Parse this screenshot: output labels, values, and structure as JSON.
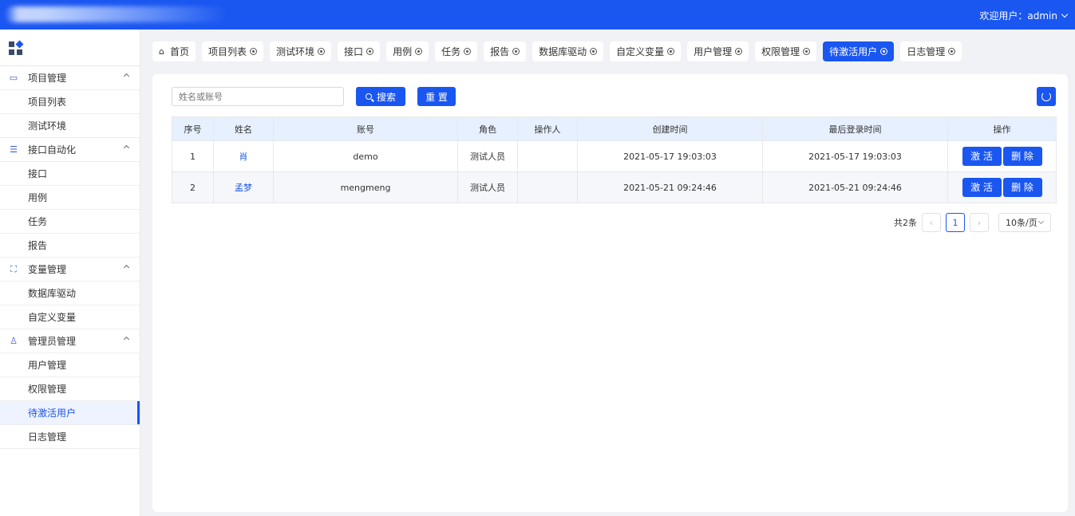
{
  "header": {
    "welcome_label": "欢迎用户：admin"
  },
  "sidebar": {
    "groups": [
      {
        "label": "项目管理",
        "icon": "folder-icon",
        "items": [
          "项目列表",
          "测试环境"
        ]
      },
      {
        "label": "接口自动化",
        "icon": "sliders-icon",
        "items": [
          "接口",
          "用例",
          "任务",
          "报告"
        ]
      },
      {
        "label": "变量管理",
        "icon": "sitemap-icon",
        "items": [
          "数据库驱动",
          "自定义变量"
        ]
      },
      {
        "label": "管理员管理",
        "icon": "user-icon",
        "items": [
          "用户管理",
          "权限管理",
          "待激活用户",
          "日志管理"
        ]
      }
    ],
    "active_item": "待激活用户"
  },
  "tabs": [
    {
      "label": "首页",
      "closable": false
    },
    {
      "label": "项目列表",
      "closable": true
    },
    {
      "label": "测试环境",
      "closable": true
    },
    {
      "label": "接口",
      "closable": true
    },
    {
      "label": "用例",
      "closable": true
    },
    {
      "label": "任务",
      "closable": true
    },
    {
      "label": "报告",
      "closable": true
    },
    {
      "label": "数据库驱动",
      "closable": true
    },
    {
      "label": "自定义变量",
      "closable": true
    },
    {
      "label": "用户管理",
      "closable": true
    },
    {
      "label": "权限管理",
      "closable": true
    },
    {
      "label": "待激活用户",
      "closable": true,
      "active": true
    },
    {
      "label": "日志管理",
      "closable": true
    }
  ],
  "search": {
    "placeholder": "姓名或账号",
    "search_label": "搜索",
    "reset_label": "重 置"
  },
  "table": {
    "columns": [
      "序号",
      "姓名",
      "账号",
      "角色",
      "操作人",
      "创建时间",
      "最后登录时间",
      "操作"
    ],
    "rows": [
      {
        "index": "1",
        "name": "肖",
        "account": "demo",
        "role": "测试人员",
        "operator": "",
        "created": "2021-05-17 19:03:03",
        "last_login": "2021-05-17 19:03:03"
      },
      {
        "index": "2",
        "name": "孟梦",
        "account": "mengmeng",
        "role": "测试人员",
        "operator": "",
        "created": "2021-05-21 09:24:46",
        "last_login": "2021-05-21 09:24:46"
      }
    ],
    "activate_label": "激 活",
    "delete_label": "删 除"
  },
  "pagination": {
    "total_label": "共2条",
    "current_page": "1",
    "page_size_label": "10条/页"
  },
  "colors": {
    "primary": "#1a56f0",
    "header_bg": "#1a56f0",
    "table_head_bg": "#e6f0ff"
  }
}
